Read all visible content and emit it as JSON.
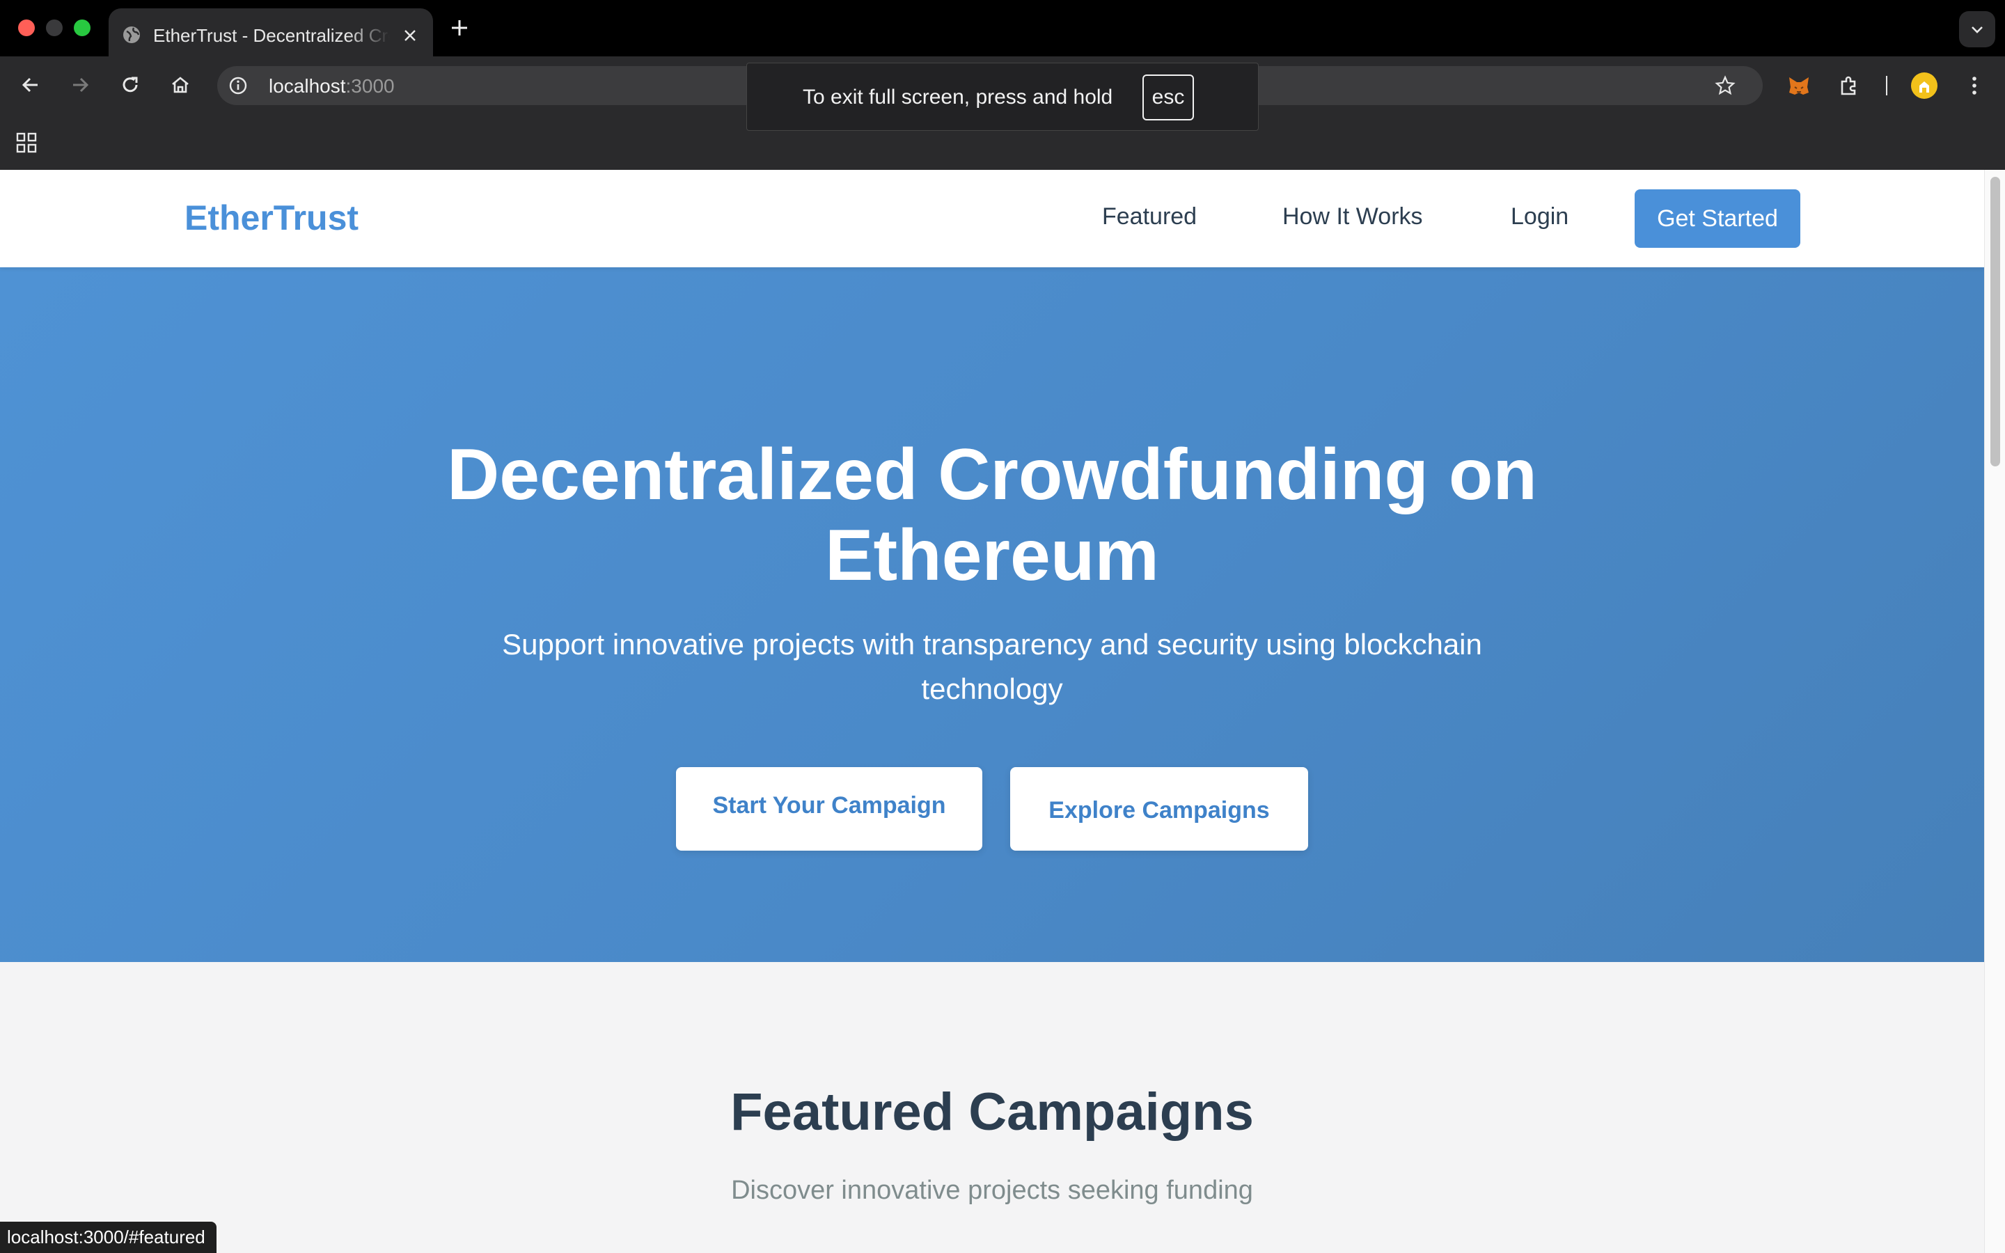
{
  "browser": {
    "tab_title": "EtherTrust - Decentralized Crowdfunding",
    "url_host": "localhost",
    "url_port": ":3000",
    "fullscreen_notice": "To exit full screen, press and hold",
    "fullscreen_key": "esc",
    "status_url": "localhost:3000/#featured",
    "icons": [
      "back-icon",
      "forward-icon",
      "reload-icon",
      "home-icon",
      "info-icon",
      "star-icon",
      "metamask-icon",
      "extensions-icon",
      "profile-icon",
      "menu-icon",
      "apps-icon"
    ]
  },
  "site": {
    "logo": "EtherTrust",
    "nav": {
      "featured": "Featured",
      "how_it_works": "How It Works",
      "login": "Login",
      "get_started": "Get Started"
    }
  },
  "hero": {
    "title": "Decentralized Crowdfunding on Ethereum",
    "subtitle": "Support innovative projects with transparency and security using blockchain technology",
    "primary_button": "Start Your Campaign",
    "secondary_button": "Explore Campaigns"
  },
  "featured": {
    "title": "Featured Campaigns",
    "subtitle": "Discover innovative projects seeking funding"
  },
  "colors": {
    "accent": "#4a90d9",
    "hero_bg": "#4a89c8",
    "heading": "#2c3e50",
    "muted": "#7f8c8d"
  }
}
